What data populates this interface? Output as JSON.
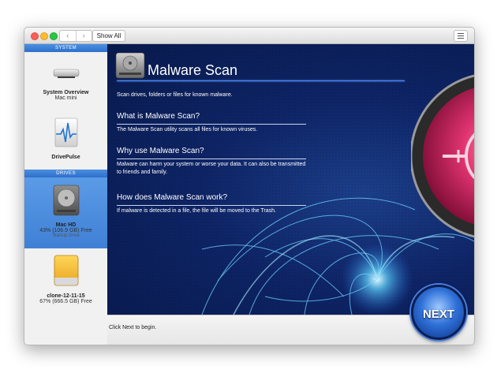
{
  "window": {
    "nav_back": "‹",
    "nav_forward": "›",
    "show_all_label": "Show All"
  },
  "sidebar": {
    "system_header": "SYSTEM",
    "drives_header": "DRIVES",
    "items": [
      {
        "name": "System Overview",
        "subtitle": "Mac mini",
        "icon": "mac-mini-icon"
      },
      {
        "name": "DrivePulse",
        "icon": "drivepulse-icon"
      }
    ],
    "drives": [
      {
        "name": "Mac HD",
        "usage": "43% (106.9 GB) Free",
        "note": "Startup Drive",
        "icon": "hard-drive-icon",
        "selected": true
      },
      {
        "name": "clone-12-11-15",
        "usage": "67% (666.5 GB) Free",
        "icon": "external-drive-icon",
        "selected": false
      }
    ]
  },
  "main": {
    "title": "Malware Scan",
    "intro": "Scan drives, folders or files for known malware.",
    "sections": [
      {
        "heading": "What is Malware Scan?",
        "body": "The Malware Scan utility scans all files for known viruses."
      },
      {
        "heading": "Why use Malware Scan?",
        "body": "Malware can harm your system or worse your data. It can also be transmitted to friends and family."
      },
      {
        "heading": "How does Malware Scan work?",
        "body": "If malware is detected in a file, the file will be moved to the Trash."
      }
    ],
    "next_label": "NEXT"
  },
  "footer": {
    "status": "Click Next to begin."
  },
  "colors": {
    "accent_blue": "#2f6fcc",
    "main_background": "#0e2466",
    "next_ring": "#1d4fb0",
    "magenta_glow": "#e0336f"
  }
}
